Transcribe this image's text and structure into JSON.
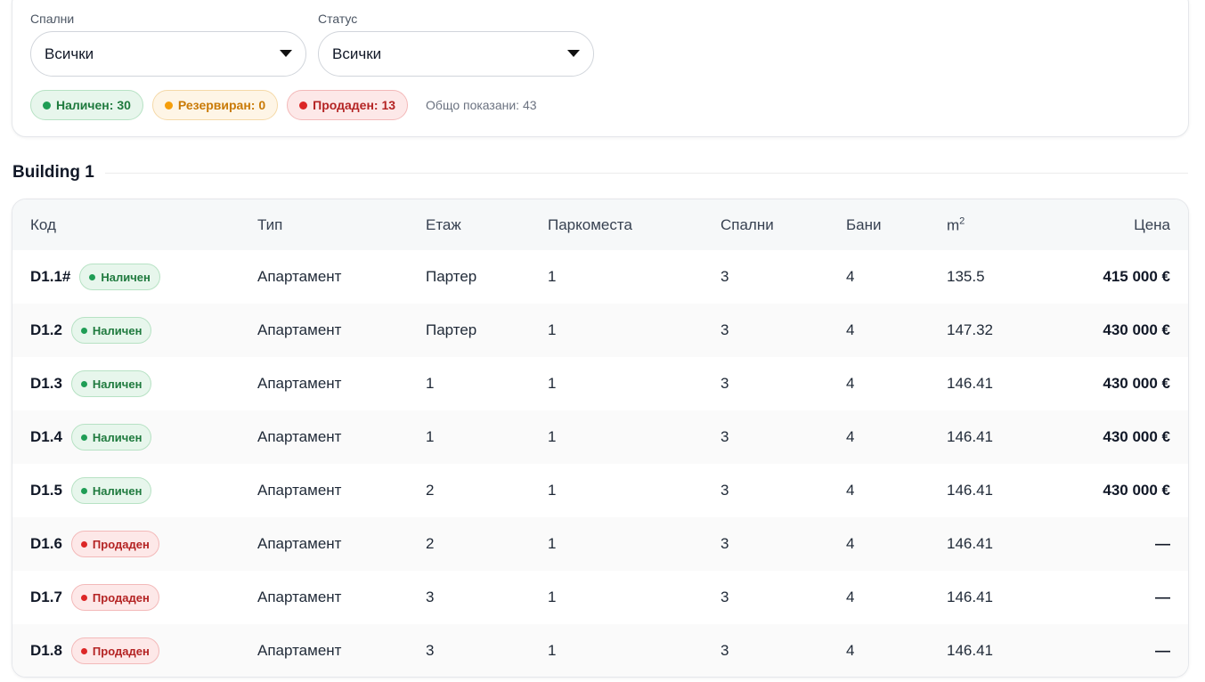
{
  "filters": {
    "bedrooms": {
      "label": "Спални",
      "value": "Всички"
    },
    "status": {
      "label": "Статус",
      "value": "Всички"
    }
  },
  "counts": {
    "available": "Наличен: 30",
    "reserved": "Резервиран: 0",
    "sold": "Продаден: 13",
    "total_shown": "Общо показани: 43"
  },
  "building": {
    "title": "Building 1",
    "columns": {
      "code": "Код",
      "type": "Тип",
      "floor": "Етаж",
      "parking": "Паркоместа",
      "bedrooms": "Спални",
      "bathrooms": "Бани",
      "area": "m",
      "area_sup": "2",
      "price": "Цена"
    },
    "rows": [
      {
        "code": "D1.1#",
        "status": "Наличен",
        "status_kind": "available",
        "type": "Апартамент",
        "floor": "Партер",
        "parking": "1",
        "bedrooms": "3",
        "bathrooms": "4",
        "area": "135.5",
        "price": "415 000 €"
      },
      {
        "code": "D1.2",
        "status": "Наличен",
        "status_kind": "available",
        "type": "Апартамент",
        "floor": "Партер",
        "parking": "1",
        "bedrooms": "3",
        "bathrooms": "4",
        "area": "147.32",
        "price": "430 000 €"
      },
      {
        "code": "D1.3",
        "status": "Наличен",
        "status_kind": "available",
        "type": "Апартамент",
        "floor": "1",
        "parking": "1",
        "bedrooms": "3",
        "bathrooms": "4",
        "area": "146.41",
        "price": "430 000 €"
      },
      {
        "code": "D1.4",
        "status": "Наличен",
        "status_kind": "available",
        "type": "Апартамент",
        "floor": "1",
        "parking": "1",
        "bedrooms": "3",
        "bathrooms": "4",
        "area": "146.41",
        "price": "430 000 €"
      },
      {
        "code": "D1.5",
        "status": "Наличен",
        "status_kind": "available",
        "type": "Апартамент",
        "floor": "2",
        "parking": "1",
        "bedrooms": "3",
        "bathrooms": "4",
        "area": "146.41",
        "price": "430 000 €"
      },
      {
        "code": "D1.6",
        "status": "Продаден",
        "status_kind": "sold",
        "type": "Апартамент",
        "floor": "2",
        "parking": "1",
        "bedrooms": "3",
        "bathrooms": "4",
        "area": "146.41",
        "price": "—"
      },
      {
        "code": "D1.7",
        "status": "Продаден",
        "status_kind": "sold",
        "type": "Апартамент",
        "floor": "3",
        "parking": "1",
        "bedrooms": "3",
        "bathrooms": "4",
        "area": "146.41",
        "price": "—"
      },
      {
        "code": "D1.8",
        "status": "Продаден",
        "status_kind": "sold",
        "type": "Апартамент",
        "floor": "3",
        "parking": "1",
        "bedrooms": "3",
        "bathrooms": "4",
        "area": "146.41",
        "price": "—"
      }
    ]
  }
}
